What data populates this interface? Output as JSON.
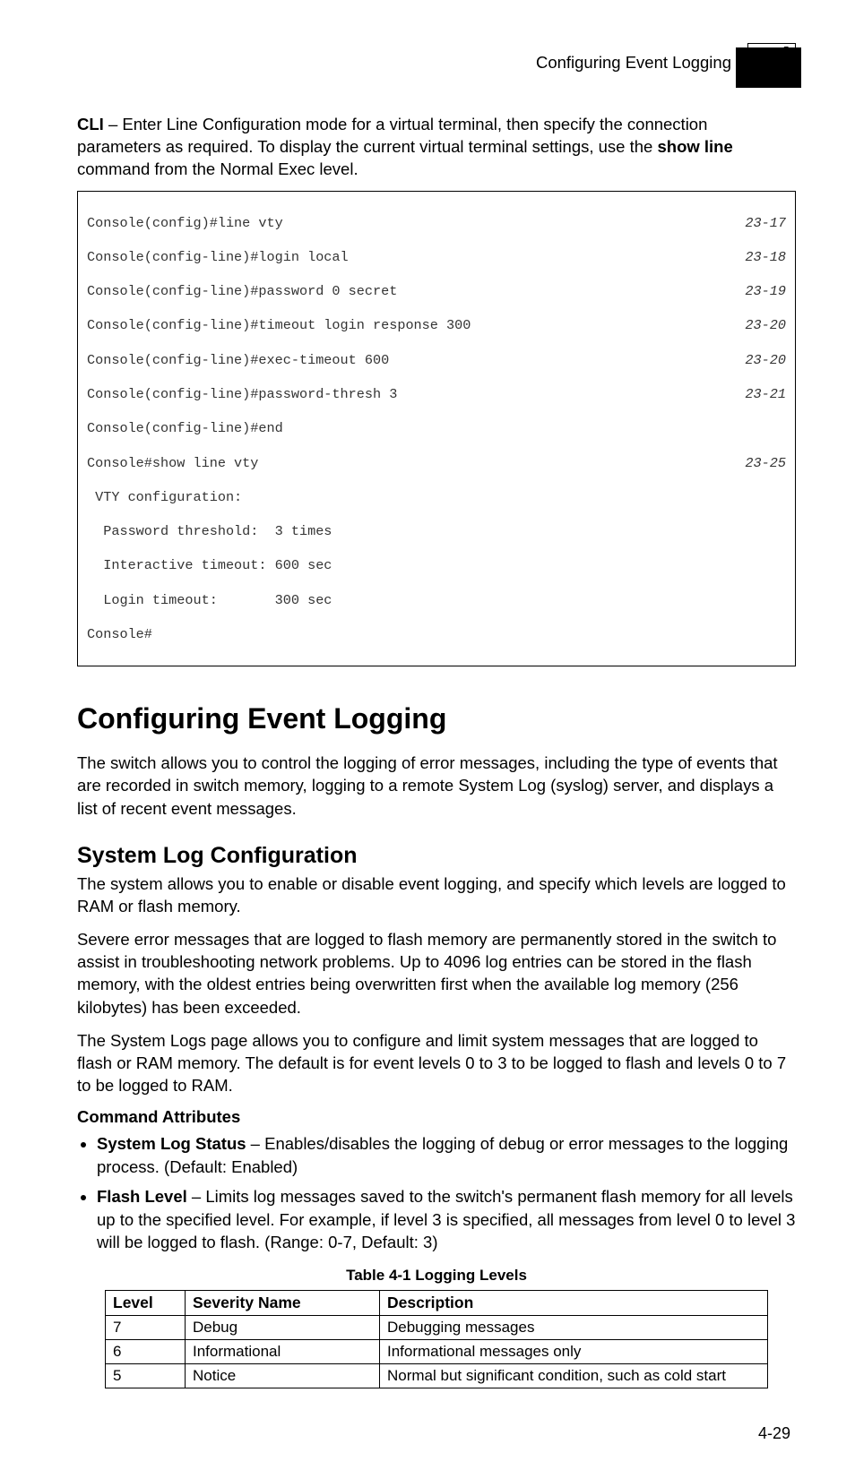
{
  "header": {
    "running_title": "Configuring Event Logging",
    "chapter_num": "4"
  },
  "intro": {
    "cli_label": "CLI",
    "cli_text": " – Enter Line Configuration mode for a virtual terminal, then specify the connection parameters as required. To display the current virtual terminal settings, use the ",
    "show_line": "show line",
    "cli_text_after": " command from the Normal Exec level."
  },
  "cli": {
    "l1_cmd": "Console(config)#line vty",
    "l1_ref": "23-17",
    "l2_cmd": "Console(config-line)#login local",
    "l2_ref": "23-18",
    "l3_cmd": "Console(config-line)#password 0 secret",
    "l3_ref": "23-19",
    "l4_cmd": "Console(config-line)#timeout login response 300",
    "l4_ref": "23-20",
    "l5_cmd": "Console(config-line)#exec-timeout 600",
    "l5_ref": "23-20",
    "l6_cmd": "Console(config-line)#password-thresh 3",
    "l6_ref": "23-21",
    "l7_cmd": "Console(config-line)#end",
    "l8_cmd": "Console#show line vty",
    "l8_ref": "23-25",
    "l9": " VTY configuration:",
    "l10": "  Password threshold:  3 times",
    "l11": "  Interactive timeout: 600 sec",
    "l12": "  Login timeout:       300 sec",
    "l13": "Console#"
  },
  "section": {
    "title": "Configuring Event Logging",
    "desc": "The switch allows you to control the logging of error messages, including the type of events that are recorded in switch memory, logging to a remote System Log (syslog) server, and displays a list of recent event messages."
  },
  "syslog": {
    "title": "System Log Configuration",
    "p1": "The system allows you to enable or disable event logging, and specify which levels are logged to RAM or flash memory.",
    "p2": "Severe error messages that are logged to flash memory are permanently stored in the switch to assist in troubleshooting network problems. Up to 4096 log entries can be stored in the flash memory, with the oldest entries being overwritten first when the available log memory (256 kilobytes) has been exceeded.",
    "p3": "The System Logs page allows you to configure and limit system messages that are logged to flash or RAM memory. The default is for event levels 0 to 3 to be logged to flash and levels 0 to 7 to be logged to RAM."
  },
  "cmdattr": {
    "heading": "Command Attributes",
    "item1_name": "System Log Status",
    "item1_text": " – Enables/disables the logging of debug or error messages to the logging process. (Default: Enabled)",
    "item2_name": "Flash Level",
    "item2_text": " – Limits log messages saved to the switch's permanent flash memory for all levels up to the specified level. For example, if level 3 is specified, all messages from level 0 to level 3 will be logged to flash. (Range: 0-7, Default: 3)"
  },
  "table": {
    "caption": "Table 4-1   Logging Levels",
    "head_level": "Level",
    "head_sev": "Severity Name",
    "head_desc": "Description",
    "r1_level": "7",
    "r1_sev": "Debug",
    "r1_desc": "Debugging messages",
    "r2_level": "6",
    "r2_sev": "Informational",
    "r2_desc": "Informational messages only",
    "r3_level": "5",
    "r3_sev": "Notice",
    "r3_desc": "Normal but significant condition, such as cold start"
  },
  "footer": {
    "page_num": "4-29"
  }
}
